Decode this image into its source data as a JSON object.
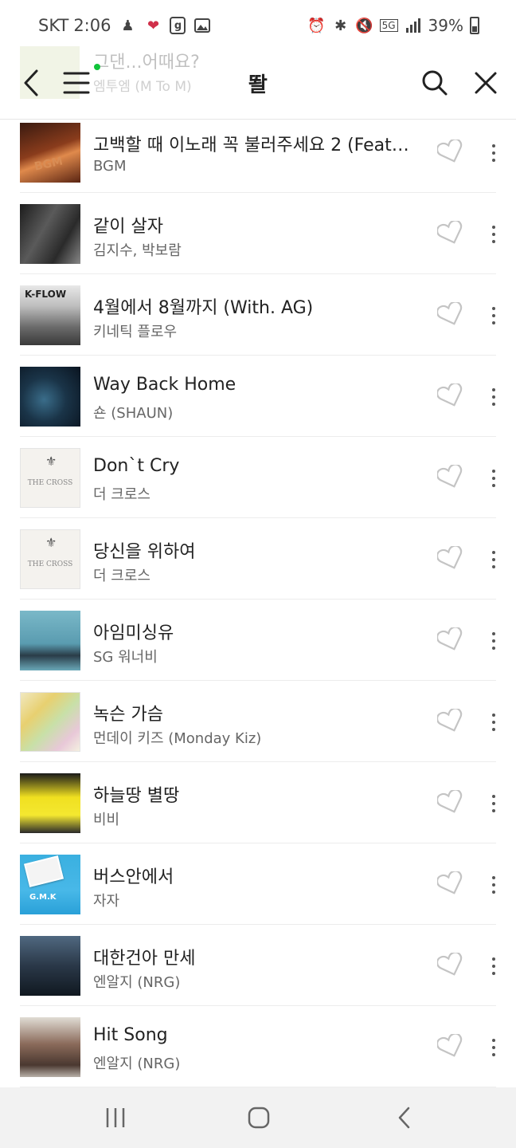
{
  "status_bar": {
    "carrier": "SKT",
    "time": "2:06",
    "notif_g": "g",
    "network": "5G",
    "battery": "39%"
  },
  "mini_player": {
    "title": "그댄...어때요?",
    "artist": "엠투엠 (M To M)"
  },
  "header": {
    "title": "똴"
  },
  "songs": [
    {
      "title": "고백할 때 이노래 꼭 불러주세요 2 (Feat....",
      "artist": "BGM"
    },
    {
      "title": "같이 살자",
      "artist": "김지수, 박보람"
    },
    {
      "title": "4월에서 8월까지 (With. AG)",
      "artist": "키네틱 플로우"
    },
    {
      "title": "Way Back Home",
      "artist": "숀 (SHAUN)"
    },
    {
      "title": "Don`t Cry",
      "artist": "더 크로스"
    },
    {
      "title": "당신을 위하여",
      "artist": "더 크로스"
    },
    {
      "title": "아임미싱유",
      "artist": "SG 워너비"
    },
    {
      "title": "녹슨 가슴",
      "artist": "먼데이 키즈 (Monday Kiz)"
    },
    {
      "title": "하늘땅 별땅",
      "artist": "비비"
    },
    {
      "title": "버스안에서",
      "artist": "자자"
    },
    {
      "title": "대한건아 만세",
      "artist": "엔알지 (NRG)"
    },
    {
      "title": "Hit Song",
      "artist": "엔알지 (NRG)"
    }
  ],
  "album_art_text": [
    "BGM",
    "K-FLOW",
    "THE CROSS",
    "THE CROSS",
    "G.M.K"
  ],
  "colors": {
    "accent_dot": "#10c43a",
    "divider": "#ececec",
    "nav_bg": "#f2f2f2"
  }
}
